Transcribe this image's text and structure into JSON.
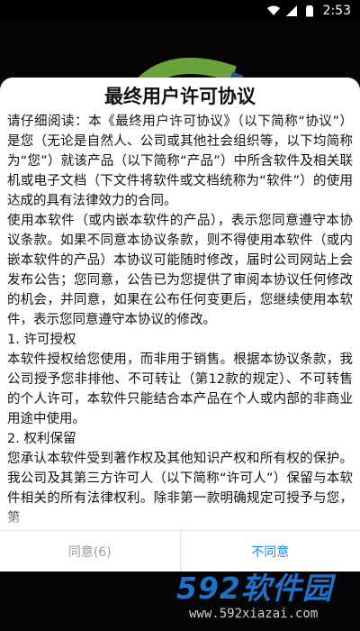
{
  "status_bar": {
    "time": "2:53",
    "icons": [
      "wifi-icon",
      "signal-icon",
      "battery-icon"
    ]
  },
  "dialog": {
    "title": "最终用户许可协议",
    "paragraphs": [
      "请仔细阅读：本《最终用户许可协议》（以下简称“协议”）是您（无论是自然人、公司或其他社会组织等，以下均简称为“您”）就该产品（以下简称“产品”）中所含软件及相关联机或电子文档（下文件将软件或文档统称为“软件”）的使用达成的具有法律效力的合同。",
      "使用本软件（或内嵌本软件的产品），表示您同意遵守本协议条款。如果不同意本协议条款，则不得使用本软件（或内嵌本软件的产品）本协议可能随时修改，届时公司网站上会发布公告；您同意，公告已为您提供了审阅本协议任何修改的机会，并同意，如果在公布任何变更后，您继续使用本软件，表示您同意遵守本协议的修改。",
      "1. 许可授权",
      "本软件授权给您使用，而非用于销售。根据本协议条款，我公司授予您非排他、不可转让（第12款的规定）、不可转售的个人许可，本软件只能结合本产品在个人或内部的非商业用途中使用。",
      "2. 权利保留",
      "您承认本软件受到著作权及其他知识产权和所有权的保护。我公司及其第三方许可人（以下简称“许可人”）保留与本软件相关的所有法律权利。除非第一款明确规定可授予与您，第"
    ],
    "agree_label": "同意(6)",
    "disagree_label": "不同意"
  },
  "watermark": {
    "title": "592软件园",
    "url": "www.592xiazai.com"
  },
  "colors": {
    "accent": "#1e88e5",
    "watermark_blue": "#1e73c8",
    "disabled_text": "#9a9a9a"
  }
}
